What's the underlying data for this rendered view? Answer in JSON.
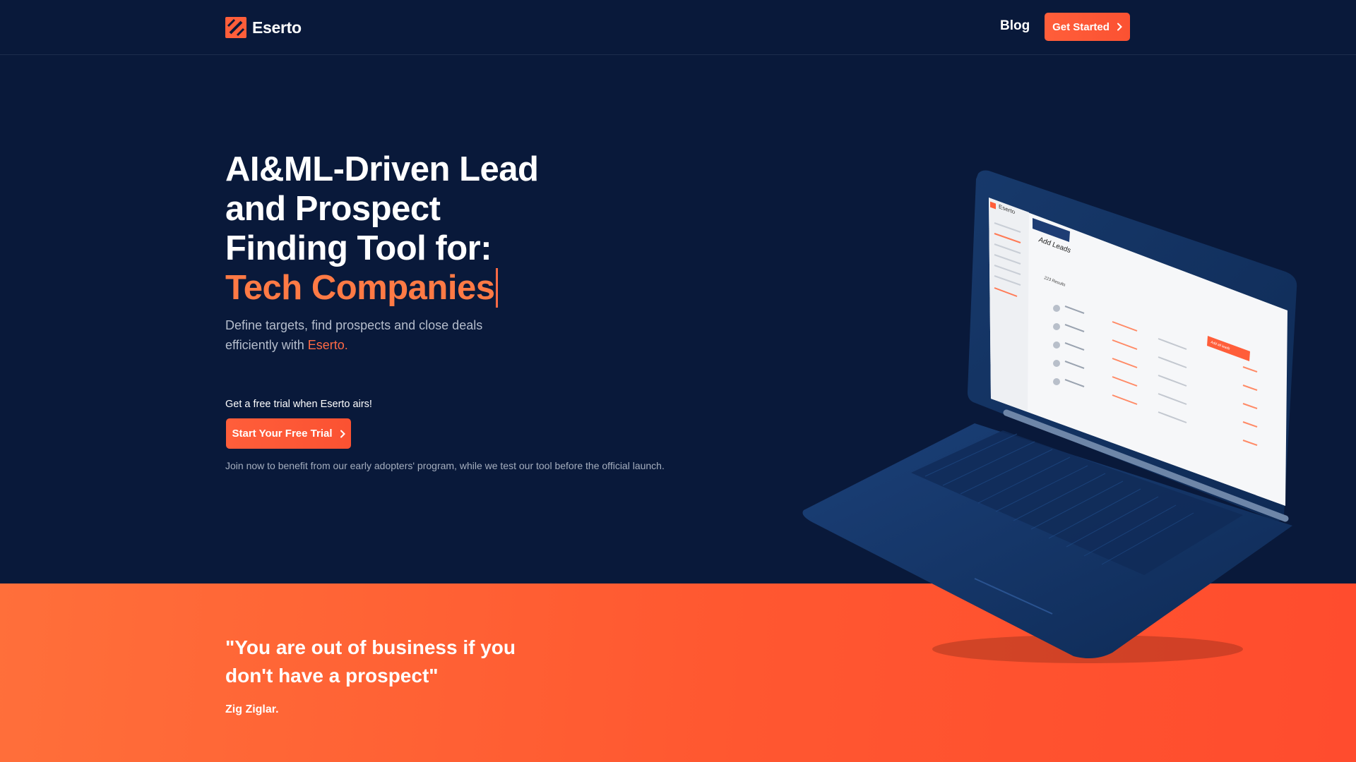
{
  "header": {
    "brand": "Eserto",
    "nav_blog": "Blog",
    "cta_label": "Get Started"
  },
  "hero": {
    "title_lines": [
      "AI&ML-Driven Lead",
      "and Prospect",
      "Finding Tool for:"
    ],
    "title_accent": "Tech Companies",
    "subtitle_line1": "Define targets, find prospects and close deals",
    "subtitle_line2_prefix": "efficiently with",
    "subtitle_brand": "Eserto.",
    "trial_label": "Get a free trial when Eserto airs!",
    "trial_button": "Start Your Free Trial",
    "join_note": "Join now to benefit from our early adopters' program, while we test our tool before the official launch."
  },
  "laptop_screen": {
    "brand": "Eserto",
    "heading": "Add Leads",
    "results": "223 Results",
    "action_button": "Add all leads"
  },
  "quote": {
    "line1": "\"You are out of business if you",
    "line2": "don't have a prospect\"",
    "author": "Zig Ziglar."
  },
  "colors": {
    "background": "#09193a",
    "accent": "#ff5e3a",
    "accent_text": "#ff7a45",
    "muted_text": "#b5bdcc"
  },
  "icons": {
    "logo": "eserto-logo-icon",
    "button_chevron": "chevron-right-icon"
  }
}
